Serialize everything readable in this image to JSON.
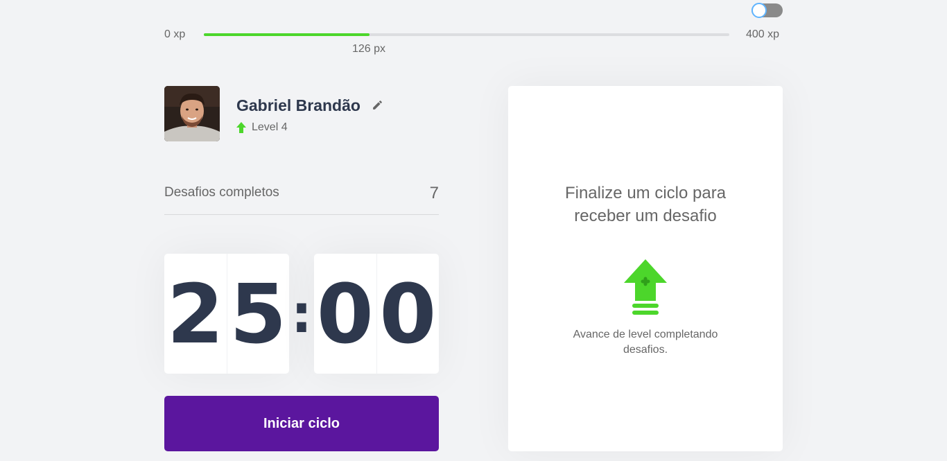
{
  "theme_toggle": {
    "state": "off"
  },
  "experience_bar": {
    "min_label": "0 xp",
    "max_label": "400 xp",
    "current_label": "126 px",
    "progress_percent": 31.5,
    "fill_color": "#4cd62b"
  },
  "profile": {
    "avatar_alt": "avatar",
    "name": "Gabriel Brandão",
    "edit_icon": "pencil-icon",
    "level_icon": "level-up-arrow-icon",
    "level_label": "Level 4"
  },
  "completed_challenges": {
    "label": "Desafios completos",
    "count": "7"
  },
  "countdown": {
    "minute_left": "2",
    "minute_right": "5",
    "separator": ":",
    "second_left": "0",
    "second_right": "0"
  },
  "start_button": {
    "label": "Iniciar ciclo",
    "color": "#5b169e"
  },
  "challenge_box": {
    "title": "Finalize um ciclo para receber um desafio",
    "icon": "level-up-icon",
    "hint": "Avance de level completando desafios."
  }
}
